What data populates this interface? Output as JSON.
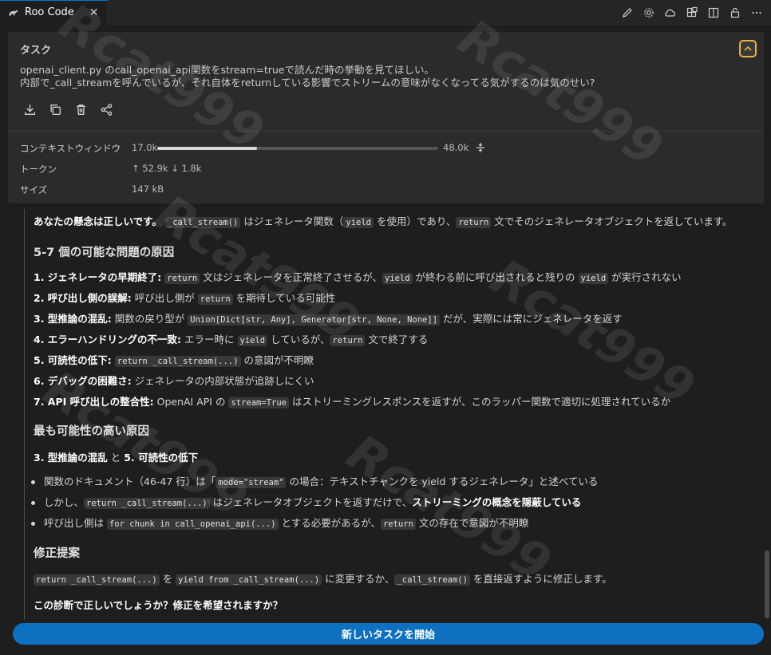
{
  "tab": {
    "title": "Roo Code",
    "close": "✕"
  },
  "task": {
    "header": "タスク",
    "line1": "openai_client.py のcall_openai_api関数をstream=trueで読んだ時の挙動を見てほしい。",
    "line2": "内部で_call_streamを呼んでいるが、それ自体をreturnしている影響でストリームの意味がなくなってる気がするのは気のせい?"
  },
  "stats": {
    "context_label": "コンテキストウィンドウ",
    "context_used": "17.0k",
    "context_max": "48.0k",
    "context_fraction": 0.354,
    "tokens_label": "トークン",
    "tokens_value": "↑ 52.9k ↓ 1.8k",
    "size_label": "サイズ",
    "size_value": "147 kB"
  },
  "message": {
    "intro_bold": "あなたの懸念は正しいです。",
    "intro_code1": "_call_stream()",
    "intro_t1": " はジェネレータ関数（",
    "intro_code2": "yield",
    "intro_t2": " を使用）であり、",
    "intro_code3": "return",
    "intro_t3": " 文でそのジェネレータオブジェクトを返しています。",
    "h_causes": "5-7 個の可能な問題の原因",
    "c1_b": "1. ジェネレータの早期終了:",
    "c1_code1": "return",
    "c1_t1": " 文はジェネレータを正常終了させるが、",
    "c1_code2": "yield",
    "c1_t2": " が終わる前に呼び出されると残りの ",
    "c1_code3": "yield",
    "c1_t3": " が実行されない",
    "c2_b": "2. 呼び出し側の誤解:",
    "c2_t1": " 呼び出し側が ",
    "c2_code1": "return",
    "c2_t2": " を期待している可能性",
    "c3_b": "3. 型推論の混乱:",
    "c3_t1": " 関数の戻り型が ",
    "c3_code1": "Union[Dict[str, Any], Generator[str, None, None]]",
    "c3_t2": " だが、実際には常にジェネレータを返す",
    "c4_b": "4. エラーハンドリングの不一致:",
    "c4_t1": " エラー時に ",
    "c4_code1": "yield",
    "c4_t2": " しているが、",
    "c4_code2": "return",
    "c4_t3": " 文で終了する",
    "c5_b": "5. 可読性の低下:",
    "c5_code1": "return _call_stream(...)",
    "c5_t1": " の意図が不明瞭",
    "c6_b": "6. デバッグの困難さ:",
    "c6_t1": " ジェネレータの内部状態が追跡しにくい",
    "c7_b": "7. API 呼び出しの整合性:",
    "c7_t1": " OpenAI API の ",
    "c7_code1": "stream=True",
    "c7_t2": " はストリーミングレスポンスを返すが、このラッパー関数で適切に処理されているか",
    "h_likely": "最も可能性の高い原因",
    "likely_b1": "3. 型推論の混乱",
    "likely_and": " と ",
    "likely_b2": "5. 可読性の低下",
    "b1_t1": "関数のドキュメント（46-47 行）は「",
    "b1_code1": "mode=\"stream\"",
    "b1_t2": " の場合：テキストチャンクを yield するジェネレータ」と述べている",
    "b2_t1": "しかし、",
    "b2_code1": "return _call_stream(...)",
    "b2_t2": " はジェネレータオブジェクトを返すだけで、",
    "b2_b": "ストリーミングの概念を隠蔽している",
    "b3_t1": "呼び出し側は ",
    "b3_code1": "for chunk in call_openai_api(...)",
    "b3_t2": " とする必要があるが、",
    "b3_code2": "return",
    "b3_t3": " 文の存在で意図が不明瞭",
    "h_fix": "修正提案",
    "fix_code1": "return _call_stream(...)",
    "fix_t1": " を ",
    "fix_code2": "yield from _call_stream(...)",
    "fix_t2": " に変更するか、",
    "fix_code3": "_call_stream()",
    "fix_t3": " を直接返すように修正します。",
    "question": "この診断で正しいでしょうか？修正を希望されますか？"
  },
  "new_task_button": "新しいタスクを開始",
  "watermark": "Rcat999"
}
